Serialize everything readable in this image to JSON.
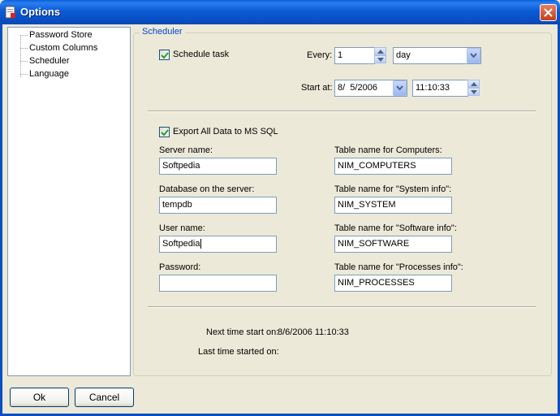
{
  "window": {
    "title": "Options",
    "close_icon": "close-icon"
  },
  "tree": {
    "items": [
      {
        "label": "Password Store"
      },
      {
        "label": "Custom Columns"
      },
      {
        "label": "Scheduler"
      },
      {
        "label": "Language"
      }
    ]
  },
  "scheduler": {
    "group_title": "Scheduler",
    "schedule_task_label": "Schedule task",
    "schedule_task_checked": true,
    "every_label": "Every:",
    "every_value": "1",
    "every_unit": "day",
    "start_at_label": "Start at:",
    "start_date": "8/  5/2006",
    "start_time": "11:10:33",
    "export_label": "Export All Data to MS SQL",
    "export_checked": true,
    "server_name_label": "Server name:",
    "server_name_value": "Softpedia",
    "database_label": "Database on the server:",
    "database_value": "tempdb",
    "user_name_label": "User name:",
    "user_name_value": "Softpedia",
    "password_label": "Password:",
    "password_value": "",
    "tbl_computers_label": "Table name for Computers:",
    "tbl_computers_value": "NIM_COMPUTERS",
    "tbl_system_label": "Table name for \"System info\":",
    "tbl_system_value": "NIM_SYSTEM",
    "tbl_software_label": "Table name for \"Software info\":",
    "tbl_software_value": "NIM_SOFTWARE",
    "tbl_processes_label": "Table name for \"Processes info\":",
    "tbl_processes_value": "NIM_PROCESSES",
    "next_time_label": "Next time start on:",
    "next_time_value": "8/6/2006 11:10:33",
    "last_time_label": "Last time started on:",
    "last_time_value": ""
  },
  "buttons": {
    "ok": "Ok",
    "cancel": "Cancel"
  },
  "colors": {
    "title_bar": "#0a5fd8",
    "group_title": "#0046d5",
    "input_border": "#7f9db9"
  }
}
